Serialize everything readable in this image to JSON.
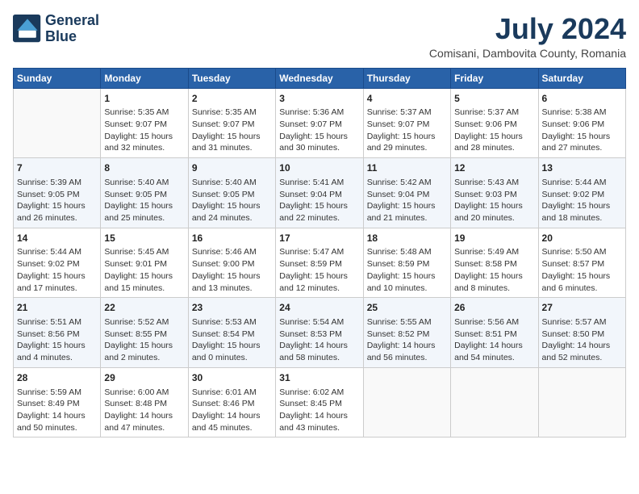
{
  "header": {
    "logo_line1": "General",
    "logo_line2": "Blue",
    "month": "July 2024",
    "location": "Comisani, Dambovita County, Romania"
  },
  "weekdays": [
    "Sunday",
    "Monday",
    "Tuesday",
    "Wednesday",
    "Thursday",
    "Friday",
    "Saturday"
  ],
  "weeks": [
    [
      {
        "day": "",
        "info": ""
      },
      {
        "day": "1",
        "info": "Sunrise: 5:35 AM\nSunset: 9:07 PM\nDaylight: 15 hours\nand 32 minutes."
      },
      {
        "day": "2",
        "info": "Sunrise: 5:35 AM\nSunset: 9:07 PM\nDaylight: 15 hours\nand 31 minutes."
      },
      {
        "day": "3",
        "info": "Sunrise: 5:36 AM\nSunset: 9:07 PM\nDaylight: 15 hours\nand 30 minutes."
      },
      {
        "day": "4",
        "info": "Sunrise: 5:37 AM\nSunset: 9:07 PM\nDaylight: 15 hours\nand 29 minutes."
      },
      {
        "day": "5",
        "info": "Sunrise: 5:37 AM\nSunset: 9:06 PM\nDaylight: 15 hours\nand 28 minutes."
      },
      {
        "day": "6",
        "info": "Sunrise: 5:38 AM\nSunset: 9:06 PM\nDaylight: 15 hours\nand 27 minutes."
      }
    ],
    [
      {
        "day": "7",
        "info": "Sunrise: 5:39 AM\nSunset: 9:05 PM\nDaylight: 15 hours\nand 26 minutes."
      },
      {
        "day": "8",
        "info": "Sunrise: 5:40 AM\nSunset: 9:05 PM\nDaylight: 15 hours\nand 25 minutes."
      },
      {
        "day": "9",
        "info": "Sunrise: 5:40 AM\nSunset: 9:05 PM\nDaylight: 15 hours\nand 24 minutes."
      },
      {
        "day": "10",
        "info": "Sunrise: 5:41 AM\nSunset: 9:04 PM\nDaylight: 15 hours\nand 22 minutes."
      },
      {
        "day": "11",
        "info": "Sunrise: 5:42 AM\nSunset: 9:04 PM\nDaylight: 15 hours\nand 21 minutes."
      },
      {
        "day": "12",
        "info": "Sunrise: 5:43 AM\nSunset: 9:03 PM\nDaylight: 15 hours\nand 20 minutes."
      },
      {
        "day": "13",
        "info": "Sunrise: 5:44 AM\nSunset: 9:02 PM\nDaylight: 15 hours\nand 18 minutes."
      }
    ],
    [
      {
        "day": "14",
        "info": "Sunrise: 5:44 AM\nSunset: 9:02 PM\nDaylight: 15 hours\nand 17 minutes."
      },
      {
        "day": "15",
        "info": "Sunrise: 5:45 AM\nSunset: 9:01 PM\nDaylight: 15 hours\nand 15 minutes."
      },
      {
        "day": "16",
        "info": "Sunrise: 5:46 AM\nSunset: 9:00 PM\nDaylight: 15 hours\nand 13 minutes."
      },
      {
        "day": "17",
        "info": "Sunrise: 5:47 AM\nSunset: 8:59 PM\nDaylight: 15 hours\nand 12 minutes."
      },
      {
        "day": "18",
        "info": "Sunrise: 5:48 AM\nSunset: 8:59 PM\nDaylight: 15 hours\nand 10 minutes."
      },
      {
        "day": "19",
        "info": "Sunrise: 5:49 AM\nSunset: 8:58 PM\nDaylight: 15 hours\nand 8 minutes."
      },
      {
        "day": "20",
        "info": "Sunrise: 5:50 AM\nSunset: 8:57 PM\nDaylight: 15 hours\nand 6 minutes."
      }
    ],
    [
      {
        "day": "21",
        "info": "Sunrise: 5:51 AM\nSunset: 8:56 PM\nDaylight: 15 hours\nand 4 minutes."
      },
      {
        "day": "22",
        "info": "Sunrise: 5:52 AM\nSunset: 8:55 PM\nDaylight: 15 hours\nand 2 minutes."
      },
      {
        "day": "23",
        "info": "Sunrise: 5:53 AM\nSunset: 8:54 PM\nDaylight: 15 hours\nand 0 minutes."
      },
      {
        "day": "24",
        "info": "Sunrise: 5:54 AM\nSunset: 8:53 PM\nDaylight: 14 hours\nand 58 minutes."
      },
      {
        "day": "25",
        "info": "Sunrise: 5:55 AM\nSunset: 8:52 PM\nDaylight: 14 hours\nand 56 minutes."
      },
      {
        "day": "26",
        "info": "Sunrise: 5:56 AM\nSunset: 8:51 PM\nDaylight: 14 hours\nand 54 minutes."
      },
      {
        "day": "27",
        "info": "Sunrise: 5:57 AM\nSunset: 8:50 PM\nDaylight: 14 hours\nand 52 minutes."
      }
    ],
    [
      {
        "day": "28",
        "info": "Sunrise: 5:59 AM\nSunset: 8:49 PM\nDaylight: 14 hours\nand 50 minutes."
      },
      {
        "day": "29",
        "info": "Sunrise: 6:00 AM\nSunset: 8:48 PM\nDaylight: 14 hours\nand 47 minutes."
      },
      {
        "day": "30",
        "info": "Sunrise: 6:01 AM\nSunset: 8:46 PM\nDaylight: 14 hours\nand 45 minutes."
      },
      {
        "day": "31",
        "info": "Sunrise: 6:02 AM\nSunset: 8:45 PM\nDaylight: 14 hours\nand 43 minutes."
      },
      {
        "day": "",
        "info": ""
      },
      {
        "day": "",
        "info": ""
      },
      {
        "day": "",
        "info": ""
      }
    ]
  ]
}
